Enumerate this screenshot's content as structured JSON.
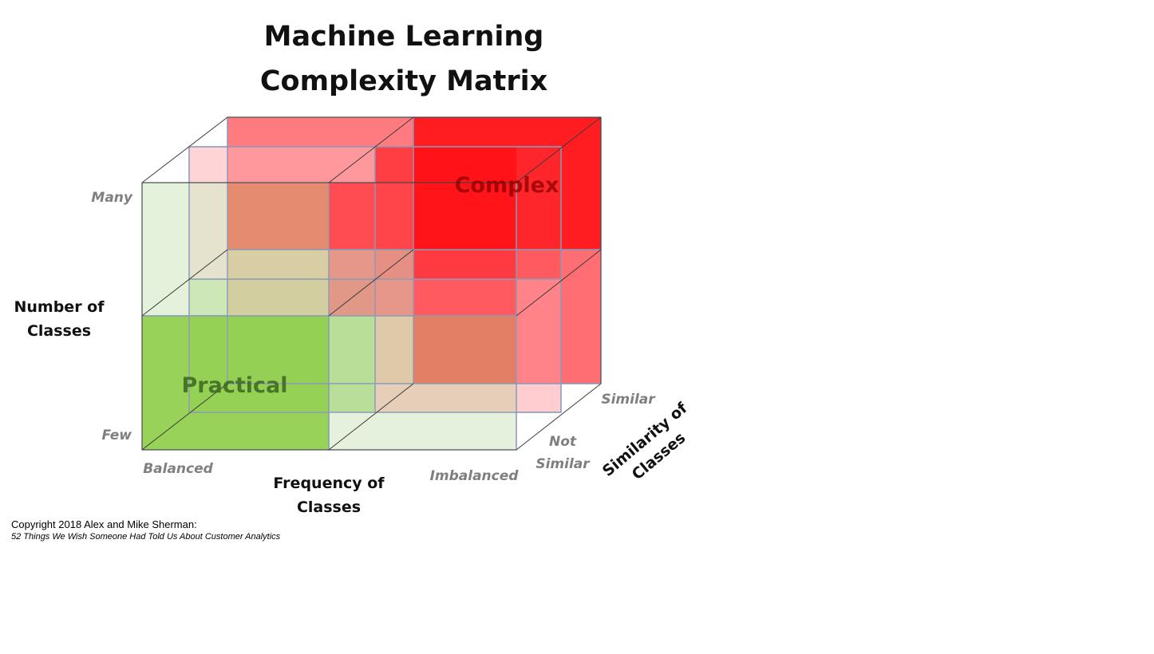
{
  "title": {
    "line1": "Machine Learning",
    "line2": "Complexity  Matrix"
  },
  "y_axis": {
    "title_line1": "Number of",
    "title_line2": "Classes",
    "tick_high": "Many",
    "tick_low": "Few"
  },
  "x_axis": {
    "title_line1": "Frequency of",
    "title_line2": "Classes",
    "tick_left": "Balanced",
    "tick_right": "Imbalanced"
  },
  "z_axis": {
    "title_line1": "Similarity of",
    "title_line2": "Classes",
    "tick_far": "Similar",
    "tick_near_line1": "Not",
    "tick_near_line2": "Similar"
  },
  "cells": {
    "practical": "Practical",
    "complex": "Complex"
  },
  "colors": {
    "practical": "#92d050",
    "complex": "#ff0000",
    "light_green": "#e2f0d9",
    "light_red": "#ffc7ce"
  },
  "copyright": {
    "line1": "Copyright 2018 Alex and Mike Sherman:",
    "line2": "52 Things We Wish Someone Had Told Us About Customer Analytics"
  }
}
